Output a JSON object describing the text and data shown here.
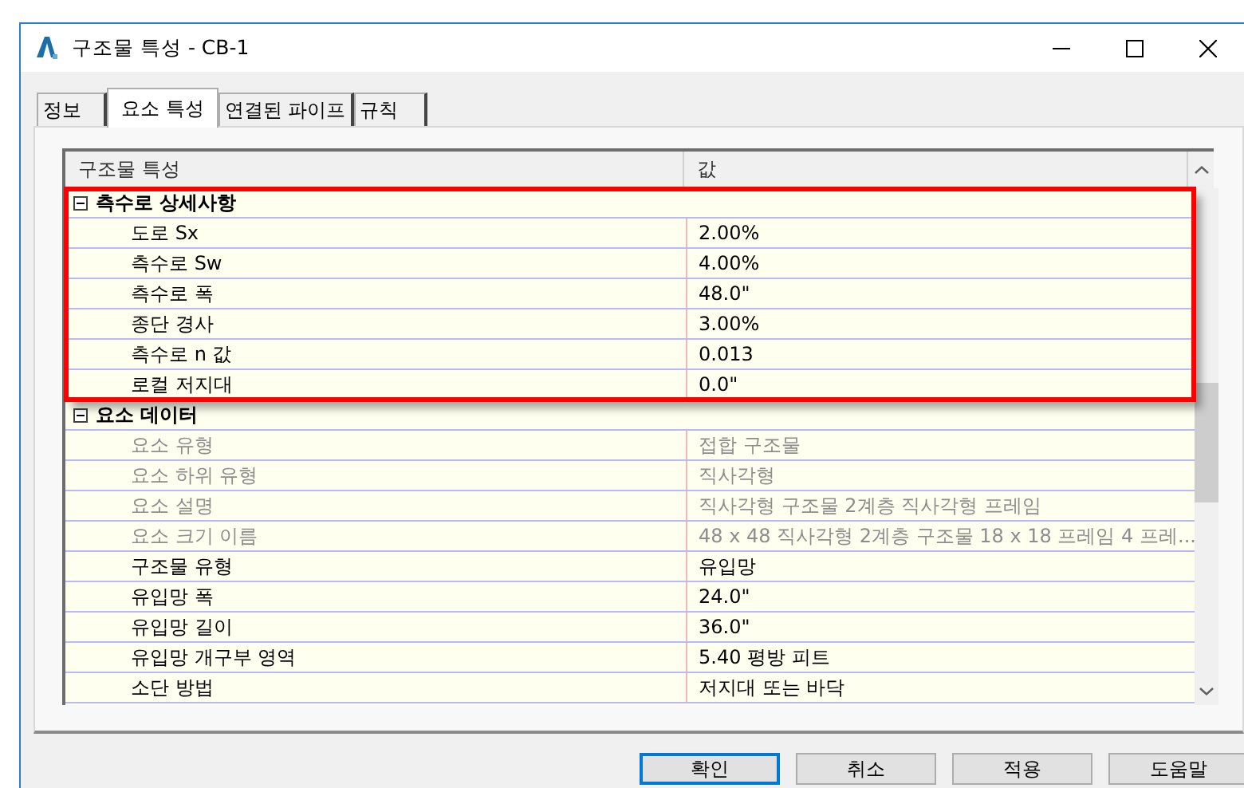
{
  "window": {
    "title": "구조물 특성 - CB-1"
  },
  "tabs": [
    {
      "label": "정보",
      "selected": false
    },
    {
      "label": "요소 특성",
      "selected": true
    },
    {
      "label": "연결된 파이프",
      "selected": false
    },
    {
      "label": "규칙",
      "selected": false
    }
  ],
  "grid": {
    "columns": [
      "구조물 특성",
      "값"
    ],
    "groups": [
      {
        "label": "측수로 상세사항",
        "expanded": true,
        "highlighted": true,
        "rows": [
          {
            "name": "도로 Sx",
            "value": "2.00%",
            "disabled": false
          },
          {
            "name": "측수로 Sw",
            "value": "4.00%",
            "disabled": false
          },
          {
            "name": "측수로 폭",
            "value": "48.0\"",
            "disabled": false
          },
          {
            "name": "종단 경사",
            "value": "3.00%",
            "disabled": false
          },
          {
            "name": "측수로 n 값",
            "value": "0.013",
            "disabled": false
          },
          {
            "name": "로컬 저지대",
            "value": "0.0\"",
            "disabled": false
          }
        ]
      },
      {
        "label": "요소 데이터",
        "expanded": true,
        "highlighted": false,
        "rows": [
          {
            "name": "요소 유형",
            "value": "접합 구조물",
            "disabled": true
          },
          {
            "name": "요소 하위 유형",
            "value": "직사각형",
            "disabled": true
          },
          {
            "name": "요소 설명",
            "value": "직사각형 구조물 2계층 직사각형 프레임",
            "disabled": true
          },
          {
            "name": "요소 크기 이름",
            "value": "48 x 48 직사각형 2계층 구조물 18 x 18 프레임 4 프레...",
            "disabled": true
          },
          {
            "name": "구조물 유형",
            "value": "유입망",
            "disabled": false
          },
          {
            "name": "유입망 폭",
            "value": "24.0\"",
            "disabled": false
          },
          {
            "name": "유입망 길이",
            "value": "36.0\"",
            "disabled": false
          },
          {
            "name": "유입망 개구부 영역",
            "value": "5.40 평방 피트",
            "disabled": false
          },
          {
            "name": "소단 방법",
            "value": "저지대 또는 바닥",
            "disabled": false
          }
        ]
      }
    ]
  },
  "buttons": [
    {
      "label": "확인",
      "default": true
    },
    {
      "label": "취소",
      "default": false
    },
    {
      "label": "적용",
      "default": false
    },
    {
      "label": "도움말",
      "default": false
    }
  ]
}
